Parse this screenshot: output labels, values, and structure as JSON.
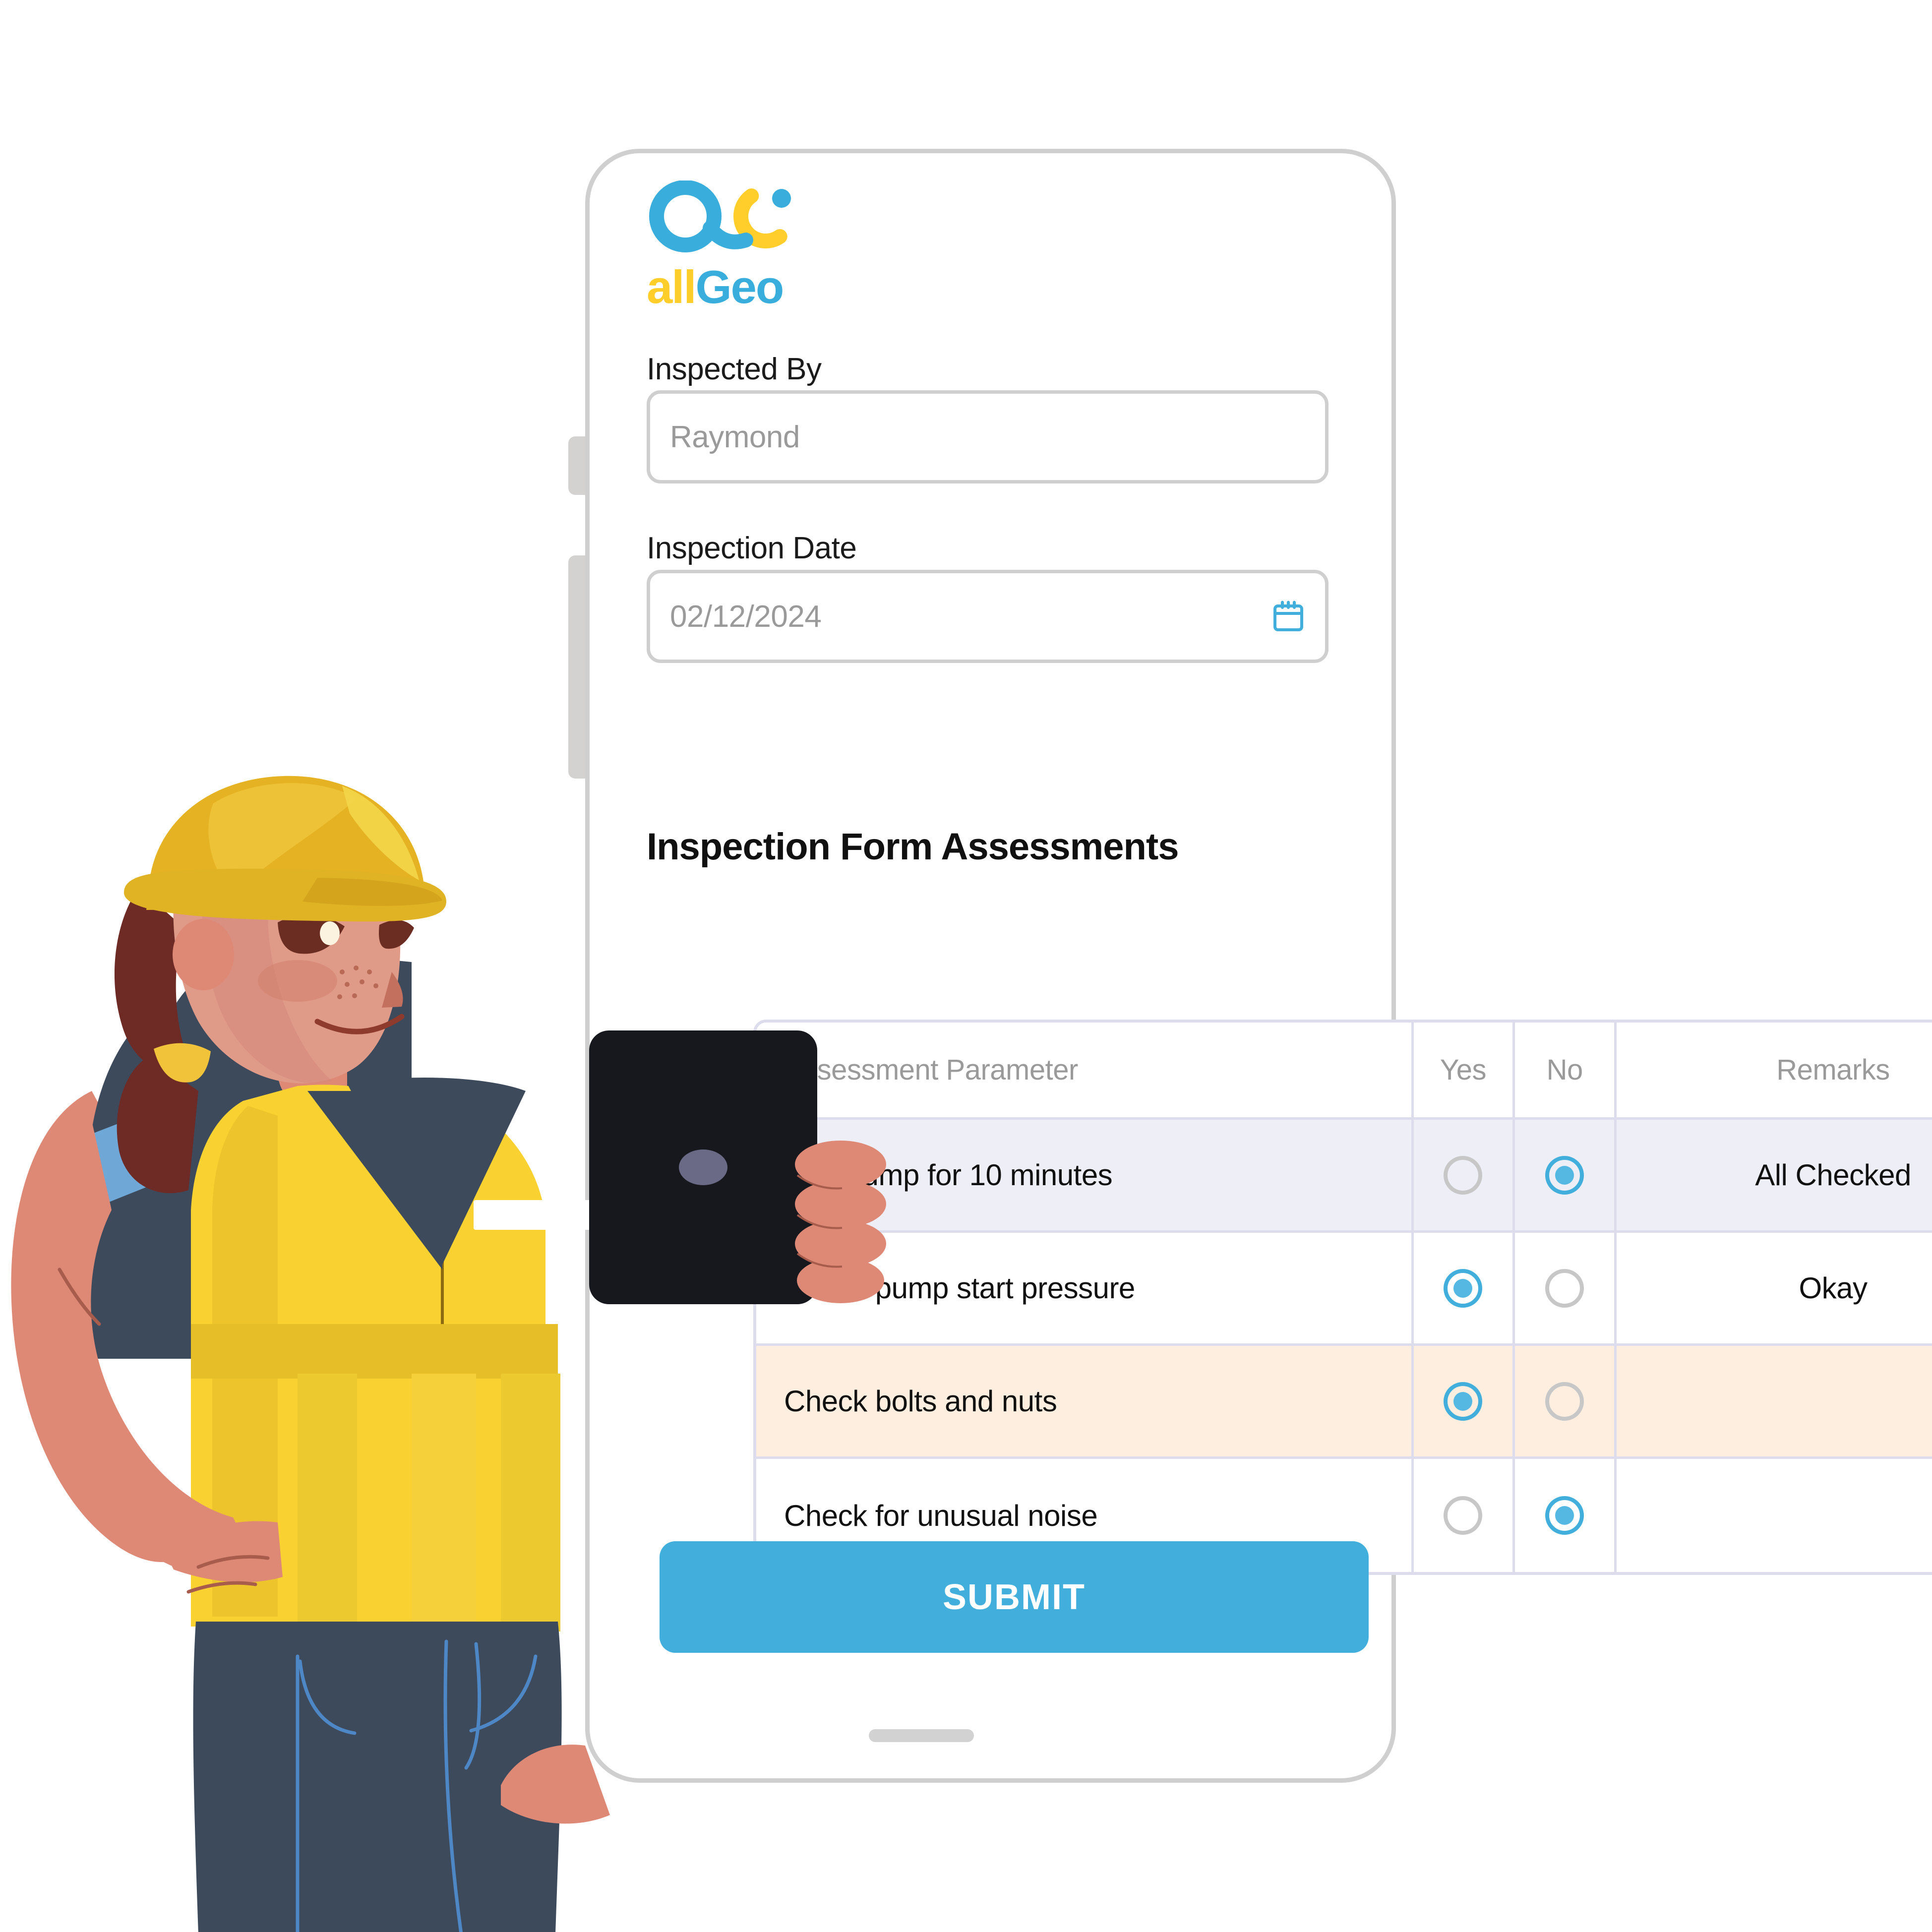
{
  "brand": {
    "name": "allGeo",
    "name_part1": "all",
    "name_part2": "Geo",
    "logo_blue": "#39ADDC",
    "logo_yellow": "#FFCE2B"
  },
  "form": {
    "inspected_by": {
      "label": "Inspected By",
      "value": "Raymond",
      "placeholder": "Raymond"
    },
    "inspection_date": {
      "label": "Inspection Date",
      "value": "02/12/2024",
      "placeholder": "02/12/2024",
      "icon": "calendar-icon",
      "icon_color": "#41AEDC"
    },
    "section_title": "Inspection Form Assessments",
    "submit_label": "SUBMIT",
    "submit_color": "#41AEDC"
  },
  "table": {
    "headers": [
      "Assessment Parameter",
      "Yes",
      "No",
      "Remarks"
    ],
    "rows": [
      {
        "parameter": "Run pump for 10 minutes",
        "yes": false,
        "no": true,
        "remarks": "All Checked",
        "row_color": "#eeeef7"
      },
      {
        "parameter": "Check pump start pressure",
        "yes": true,
        "no": false,
        "remarks": "Okay",
        "row_color": "#ffffff"
      },
      {
        "parameter": "Check bolts and nuts",
        "yes": true,
        "no": false,
        "remarks": "",
        "row_color": "#fdeee0"
      },
      {
        "parameter": "Check for unusual noise",
        "yes": false,
        "no": true,
        "remarks": "",
        "row_color": "#ffffff"
      }
    ]
  },
  "device": {
    "frame": "phone-frame",
    "home_indicator": "home-indicator",
    "volume_up_button": "volume-up-button",
    "volume_down_button": "volume-down-button",
    "tablet": "handheld-tablet"
  },
  "illustration": {
    "name": "field-worker-illustration",
    "helmet_color": "#E5B223",
    "vest_color": "#F9D231",
    "shirt_color": "#3D4A5C",
    "skin_color": "#DE8876",
    "pants_color": "#3D4A5C"
  }
}
